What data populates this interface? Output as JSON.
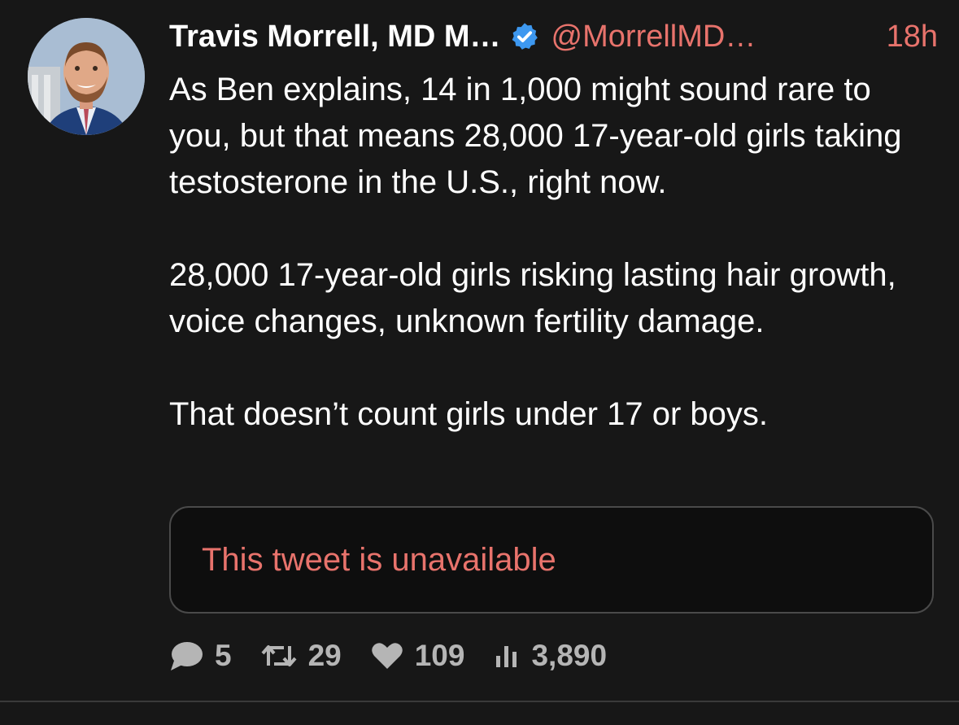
{
  "tweet": {
    "author_name": "Travis Morrell, MD M…",
    "handle": "@MorrellMD…",
    "time": "18h",
    "paragraphs": [
      "As Ben explains, 14 in 1,000 might sound rare to you, but that means 28,000 17-year-old girls taking testosterone in the U.S., right now.",
      "28,000 17-year-old girls risking lasting hair growth, voice changes, unknown fertility damage.",
      "That doesn’t count girls under 17 or boys."
    ],
    "quoted_tweet_text": "This tweet is unavailable"
  },
  "actions": {
    "replies": "5",
    "retweets": "29",
    "likes": "109",
    "views": "3,890"
  },
  "icons": {
    "verified": "verified-badge-icon",
    "reply": "comment-bubble-icon",
    "retweet": "retweet-icon",
    "like": "heart-icon",
    "views": "bar-chart-icon"
  },
  "colors": {
    "background": "#171717",
    "accent": "#e8736c",
    "verified": "#3d98f0",
    "muted": "#b5b5b5"
  }
}
